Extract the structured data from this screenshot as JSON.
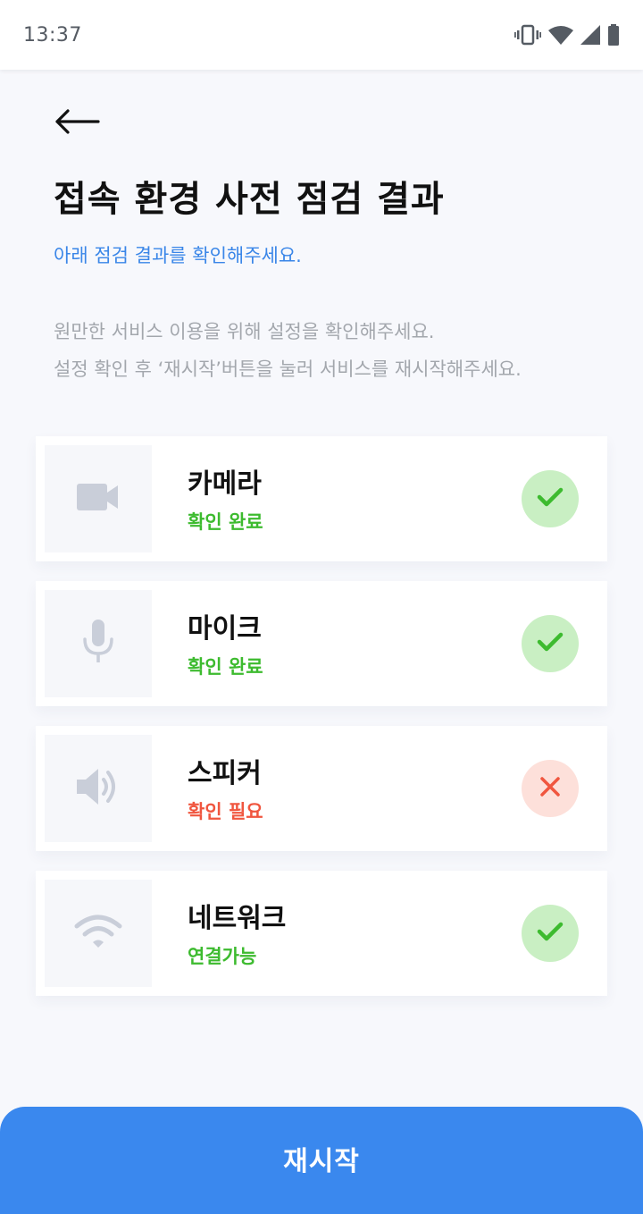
{
  "status_bar": {
    "time": "13:37",
    "icons": [
      "vibrate-icon",
      "wifi-icon",
      "cell-signal-icon",
      "battery-icon"
    ]
  },
  "header": {
    "back_icon": "arrow-left-icon",
    "title": "접속 환경 사전 점검 결과",
    "subtitle": "아래 점검 결과를 확인해주세요.",
    "description_line1": "원만한 서비스 이용을 위해 설정을 확인해주세요.",
    "description_line2": "설정 확인 후 ‘재시작’버튼을 눌러 서비스를 재시작해주세요."
  },
  "checks": [
    {
      "name": "카메라",
      "status": "확인 완료",
      "result": "ok",
      "icon": "camera-icon"
    },
    {
      "name": "마이크",
      "status": "확인 완료",
      "result": "ok",
      "icon": "microphone-icon"
    },
    {
      "name": "스피커",
      "status": "확인 필요",
      "result": "fail",
      "icon": "speaker-icon"
    },
    {
      "name": "네트워크",
      "status": "연결가능",
      "result": "ok",
      "icon": "wifi-icon"
    }
  ],
  "colors": {
    "accent": "#3a88ee",
    "ok_text": "#3dbb2f",
    "ok_badge_bg": "#c9efc3",
    "fail_text": "#f0563f",
    "fail_badge_bg": "#fde0da",
    "icon_gray": "#c9ced9"
  },
  "footer": {
    "restart_label": "재시작"
  }
}
